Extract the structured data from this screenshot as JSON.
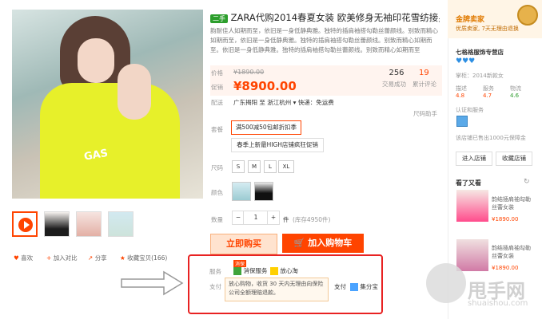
{
  "product": {
    "tag": "二手",
    "title": "ZARA代购2014春夏女装 欧美修身无袖印花雪纺接身修身无",
    "description": "韵耐佳人如期而至，依旧是一身低静典雅。独特的插肩袖搭勾勒丝蕾颜线。别致而精心如期而至，依旧是一身低静典雅。独特的插肩袖搭勾勒丝蕾颜线。别致而精心如期而至。依旧是一身低静典雅。独特的插肩袖搭勾勒丝蕾颜线。别致而精心如期而至"
  },
  "price": {
    "label_price": "价格",
    "original": "¥1890.00",
    "label_promo": "促销",
    "current": "¥8900.00",
    "label_ship": "配送",
    "ship_text": "广东揭阳 至 浙江杭州 ▾ 快递：免运费",
    "sold_count": "256",
    "sold_label": "交易成功",
    "review_count": "19",
    "review_label": "累计评论",
    "size_helper": "尺码助手"
  },
  "options": {
    "package_label": "套餐",
    "package_1": "满500减50包邮折扣季",
    "package_2": "春季上新最HIGH店铺疯狂促销",
    "size_label": "尺码",
    "sizes": [
      "S",
      "M",
      "L",
      "XL"
    ],
    "color_label": "颜色",
    "qty_label": "数量",
    "qty_value": "1",
    "qty_unit": "件",
    "stock": "(库存4950件)"
  },
  "actions": {
    "buy_now": "立即购买",
    "add_cart": "加入购物车",
    "like": "喜欢",
    "compare": "加入对比",
    "share": "分享",
    "favorite": "收藏宝贝(166)"
  },
  "service": {
    "label": "服务",
    "badge": "消保",
    "item1": "消保服务",
    "item2": "放心淘",
    "pay_label": "支付",
    "pay_item1": "支付",
    "pay_item2": "集分宝",
    "tip": "放心购物，收货 30 天内无理由向保险公司全额理赔退款。"
  },
  "seller": {
    "gold_title": "金牌卖家",
    "gold_sub": "优质卖家, 7天无理由退换",
    "shop_name": "七格格服饰专营店",
    "hearts": "♥♥♥",
    "brand": "掌柜：2014新款女",
    "desc_label": "描述",
    "desc_score": "4.8",
    "service_label": "服务",
    "service_score": "4.7",
    "ship_label": "物流",
    "ship_score": "4.6",
    "cert_label": "认证和服务",
    "sales_text": "该店铺已售出1000元保障金",
    "enter_shop": "进入店铺",
    "fav_shop": "收藏店铺"
  },
  "recommend": {
    "title": "看了又看",
    "item1_name": "韵结插肩袖勾勒丝蕾女装",
    "item1_price": "¥1890.00",
    "item2_name": "韵结插肩袖勾勒丝蕾女装",
    "item2_price": "¥1890.00"
  },
  "watermark": {
    "text": "甩手网",
    "sub": "shuaishou.com"
  }
}
